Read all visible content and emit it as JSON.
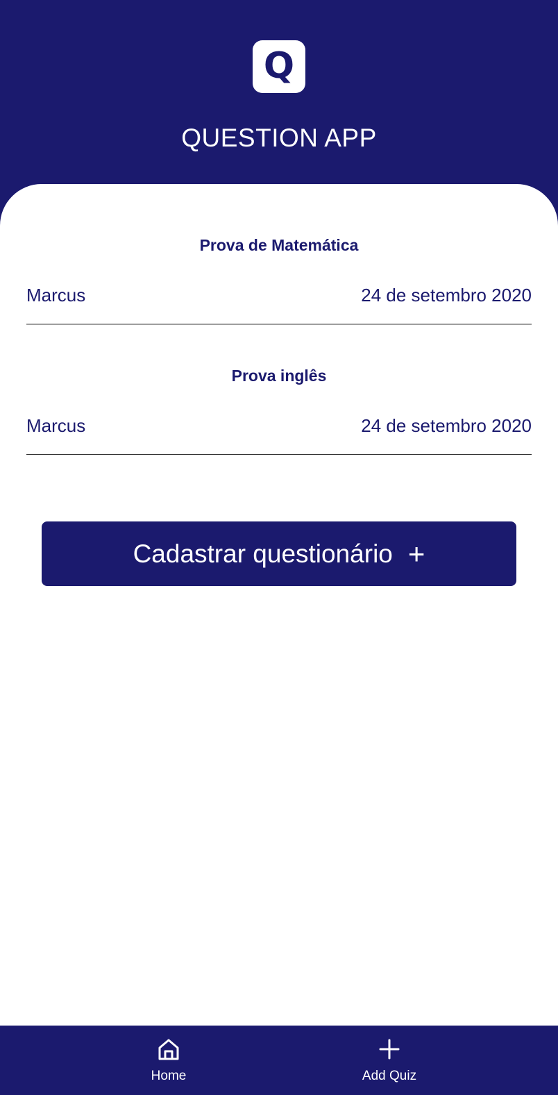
{
  "header": {
    "logo_letter": "Q",
    "title": "QUESTION APP"
  },
  "quizzes": [
    {
      "title": "Prova de Matemática",
      "author": "Marcus",
      "date": "24 de setembro 2020"
    },
    {
      "title": "Prova inglês",
      "author": "Marcus",
      "date": "24 de setembro 2020"
    }
  ],
  "actions": {
    "add_button_label": "Cadastrar questionário",
    "add_button_icon": "+"
  },
  "bottom_nav": {
    "items": [
      {
        "label": "Home",
        "icon": "home-icon"
      },
      {
        "label": "Add Quiz",
        "icon": "plus-icon"
      }
    ]
  },
  "colors": {
    "primary": "#1b1a6e",
    "background": "#ffffff",
    "divider_light": "#9e9e9e",
    "divider_dark": "#333333"
  }
}
